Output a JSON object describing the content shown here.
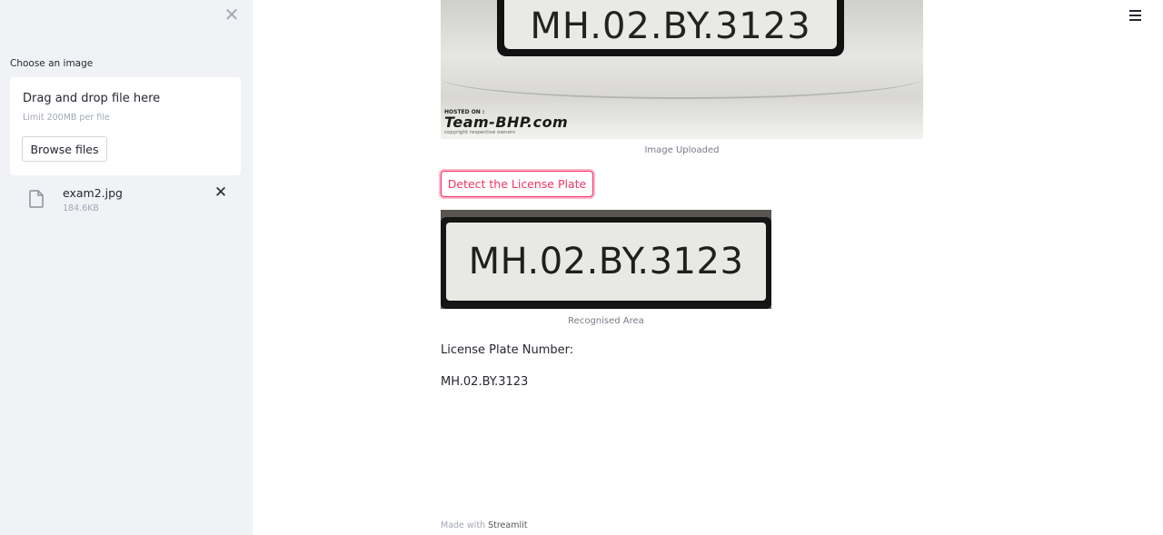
{
  "sidebar": {
    "uploader_label": "Choose an image",
    "drop_title": "Drag and drop file here",
    "drop_limit": "Limit 200MB per file",
    "browse_label": "Browse files",
    "file": {
      "name": "exam2.jpg",
      "size": "184.6KB"
    }
  },
  "main": {
    "uploaded_plate_text": "MH.02.BY.3123",
    "watermark": {
      "hosted": "HOSTED ON :",
      "logo": "Team-BHP.com",
      "copyright": "copyright respective owners"
    },
    "uploaded_caption": "Image Uploaded",
    "detect_button": "Detect the License Plate",
    "recognised_plate_text": "MH.02.BY.3123",
    "recognised_caption": "Recognised Area",
    "result_label": "License Plate Number:",
    "result_value": "MH.02.BY.3123"
  },
  "footer": {
    "prefix": "Made with",
    "brand": "Streamlit"
  },
  "colors": {
    "accent": "#f63366",
    "sidebar_bg": "#f0f2f6"
  },
  "icons": [
    "close-icon",
    "file-icon",
    "remove-icon",
    "hamburger-icon"
  ]
}
